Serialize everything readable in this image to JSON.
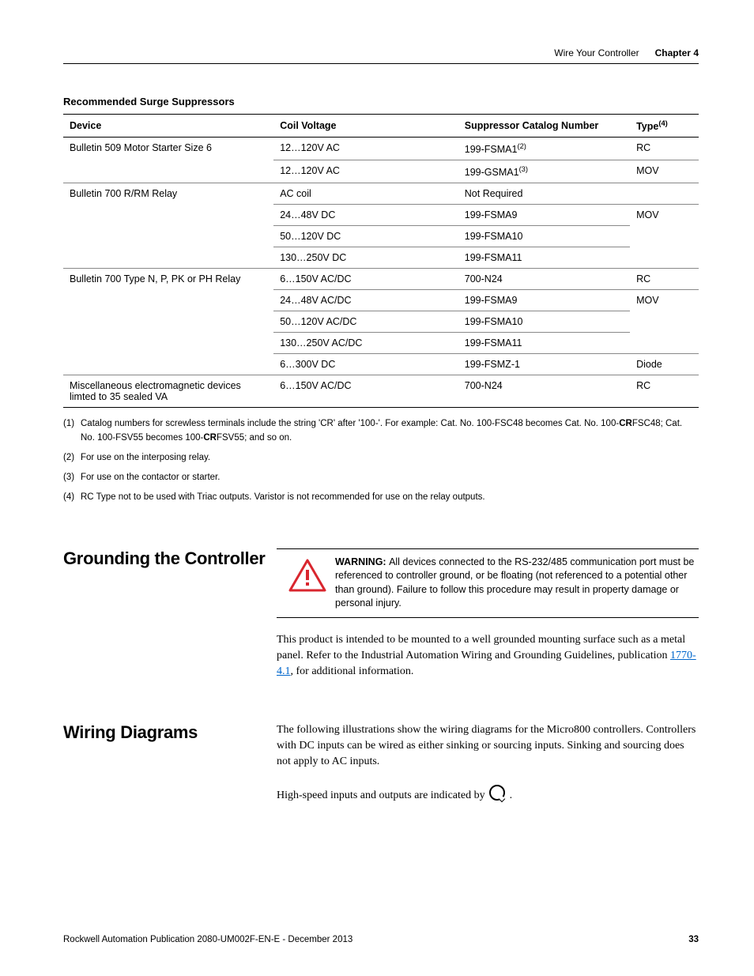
{
  "header": {
    "section": "Wire Your Controller",
    "chapter": "Chapter 4"
  },
  "table": {
    "title": "Recommended Surge Suppressors",
    "cols": {
      "device": "Device",
      "voltage": "Coil Voltage",
      "catalog": "Suppressor Catalog Number",
      "type_pre": "Type",
      "type_sup": "(4)"
    },
    "rows": [
      {
        "device": "Bulletin 509 Motor Starter Size 6",
        "voltage": "12…120V AC",
        "catalog_pre": "199-FSMA1",
        "catalog_sup": "(2)",
        "type": "RC",
        "dspan": 2
      },
      {
        "voltage": "12…120V AC",
        "catalog_pre": "199-GSMA1",
        "catalog_sup": "(3)",
        "type": "MOV"
      },
      {
        "device": "Bulletin 700 R/RM Relay",
        "voltage": "AC coil",
        "catalog_pre": "Not Required",
        "type": "",
        "dspan": 4
      },
      {
        "voltage": "24…48V DC",
        "catalog_pre": "199-FSMA9",
        "type": "MOV",
        "tspan": 3
      },
      {
        "voltage": "50…120V DC",
        "catalog_pre": "199-FSMA10"
      },
      {
        "voltage": "130…250V DC",
        "catalog_pre": "199-FSMA11"
      },
      {
        "device": "Bulletin 700 Type N, P, PK or PH Relay",
        "voltage": "6…150V AC/DC",
        "catalog_pre": "700-N24",
        "type": "RC",
        "dspan": 5
      },
      {
        "voltage": "24…48V AC/DC",
        "catalog_pre": "199-FSMA9",
        "type": "MOV",
        "tspan": 3
      },
      {
        "voltage": "50…120V AC/DC",
        "catalog_pre": "199-FSMA10"
      },
      {
        "voltage": "130…250V AC/DC",
        "catalog_pre": "199-FSMA11"
      },
      {
        "voltage": "6…300V DC",
        "catalog_pre": "199-FSMZ-1",
        "type": "Diode"
      },
      {
        "device": "Miscellaneous electromagnetic devices limted to 35 sealed VA",
        "voltage": "6…150V AC/DC",
        "catalog_pre": "700-N24",
        "type": "RC",
        "last": true
      }
    ]
  },
  "footnotes": {
    "f1n": "(1)",
    "f1a": "Catalog numbers for screwless terminals include the string 'CR' after '100-'. For example: Cat. No. 100-FSC48 becomes Cat. No. 100-",
    "f1b": "CR",
    "f1c": "FSC48; Cat. No. 100-FSV55 becomes 100-",
    "f1d": "CR",
    "f1e": "FSV55; and so on.",
    "f2n": "(2)",
    "f2": "For use on the interposing relay.",
    "f3n": "(3)",
    "f3": "For use on the contactor or starter.",
    "f4n": "(4)",
    "f4": "RC Type not to be used with Triac outputs. Varistor is not recommended for use on the relay outputs."
  },
  "grounding": {
    "heading": "Grounding the Controller",
    "warn_label": "WARNING: ",
    "warn_text": "All devices connected to the RS-232/485 communication port must be referenced to controller ground, or be floating (not referenced to a potential other than ground). Failure to follow this procedure may result in property damage or personal injury.",
    "para_pre": "This product is intended to be mounted to a well grounded mounting surface such as a metal panel. Refer to the Industrial Automation Wiring and Grounding Guidelines, publication ",
    "para_link": "1770-4.1",
    "para_post": ", for additional information."
  },
  "wiring": {
    "heading": "Wiring Diagrams",
    "para1": "The following illustrations show the wiring diagrams for the Micro800 controllers. Controllers with DC inputs can be wired as either sinking or sourcing inputs. Sinking and sourcing does not apply to AC inputs.",
    "para2_pre": "High-speed inputs and outputs are indicated by ",
    "para2_post": " ."
  },
  "footer": {
    "pub": "Rockwell Automation Publication 2080-UM002F-EN-E - December 2013",
    "page": "33"
  }
}
